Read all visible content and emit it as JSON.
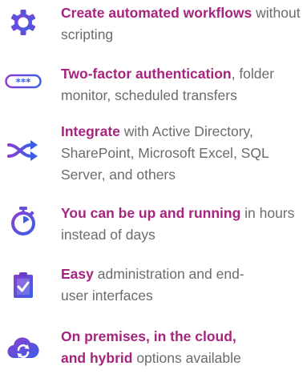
{
  "colors": {
    "accent": "#a6247e",
    "body_text": "#6b6b6b",
    "icon_purple": "#7b3fbf",
    "icon_blue": "#2f5fe0"
  },
  "features": [
    {
      "icon": "gear-icon",
      "strong": "Create automated workflows",
      "rest": " without scripting"
    },
    {
      "icon": "password-icon",
      "strong": "Two-factor authentication",
      "rest": ", folder monitor, scheduled transfers"
    },
    {
      "icon": "shuffle-icon",
      "strong": "Integrate",
      "rest": " with Active Directory, SharePoint, Microsoft Excel, SQL Server, and others"
    },
    {
      "icon": "stopwatch-icon",
      "strong": "You can be up and running",
      "rest": " in hours instead of days"
    },
    {
      "icon": "clipboard-check-icon",
      "strong": "Easy",
      "rest": " administration and end-user interfaces"
    },
    {
      "icon": "cloud-sync-icon",
      "strong": "On premises, in the cloud, and hybrid",
      "rest": " options available"
    }
  ]
}
